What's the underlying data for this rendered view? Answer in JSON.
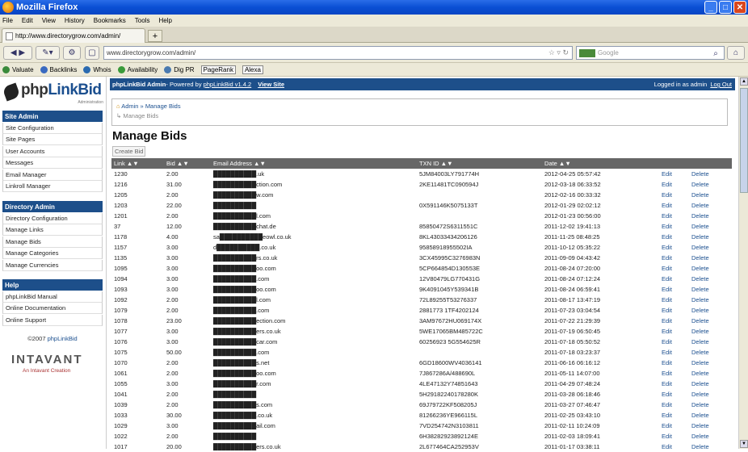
{
  "window": {
    "title": "Mozilla Firefox",
    "min": "_",
    "max": "□",
    "close": "✕"
  },
  "menu": [
    "File",
    "Edit",
    "View",
    "History",
    "Bookmarks",
    "Tools",
    "Help"
  ],
  "tab": {
    "title": "http://www.directorygrow.com/admin/",
    "new": "+"
  },
  "nav": {
    "url": "www.directorygrow.com/admin/",
    "search_placeholder": "Google"
  },
  "bookmarks": [
    {
      "label": "Valuate",
      "color": "#3a8a3a"
    },
    {
      "label": "Backlinks",
      "color": "#3a6ac0"
    },
    {
      "label": "Whois",
      "color": "#2a6ab0"
    },
    {
      "label": "Availability",
      "color": "#3a9a3a"
    },
    {
      "label": "Dig PR",
      "color": "#4a7ab0"
    },
    {
      "label": "PageRank",
      "color": ""
    },
    {
      "label": "Alexa",
      "color": ""
    }
  ],
  "sidebar": {
    "logo": {
      "brand_a": "php",
      "brand_b": "LinkBid",
      "sub": "Administration"
    },
    "sections": [
      {
        "title": "Site Admin",
        "items": [
          "Site Configuration",
          "Site Pages",
          "User Accounts",
          "Messages",
          "Email Manager",
          "Linkroll Manager"
        ]
      },
      {
        "title": "Directory Admin",
        "items": [
          "Directory Configuration",
          "Manage Links",
          "Manage Bids",
          "Manage Categories",
          "Manage Currencies"
        ]
      },
      {
        "title": "Help",
        "items": [
          "phpLinkBid Manual",
          "Online Documentation",
          "Online Support"
        ]
      }
    ],
    "copyright_pre": "©2007 ",
    "copyright_link": "phpLinkBid",
    "company": "INTAVANT",
    "company_sub": "An Intavant Creation"
  },
  "header": {
    "title": "phpLinkBid Admin",
    "powered": " - Powered by ",
    "version": "phpLinkBid v1.4.2",
    "view_site": "View Site",
    "login_text": "Logged in as admin",
    "logout": "Log Out"
  },
  "breadcrumb": {
    "admin": "Admin",
    "sep": " » ",
    "current": "Manage Bids",
    "sub": "Manage Bids"
  },
  "page": {
    "title": "Manage Bids",
    "create": "Create Bid"
  },
  "table": {
    "headers": [
      "Link ▲▼",
      "Bid ▲▼",
      "Email Address ▲▼",
      "TXN ID ▲▼",
      "Date ▲▼",
      "",
      ""
    ],
    "rows": [
      [
        "1230",
        "2.00",
        "██████████.uk",
        "5JM84003LY791774H",
        "2012-04-25 05:57:42",
        "Edit",
        "Delete"
      ],
      [
        "1216",
        "31.00",
        "██████████ction.com",
        "2KE11481TC090594J",
        "2012-03-18 06:33:52",
        "Edit",
        "Delete"
      ],
      [
        "1205",
        "2.00",
        "██████████w.com",
        "",
        "2012-02-16 00:33:32",
        "Edit",
        "Delete"
      ],
      [
        "1203",
        "22.00",
        "██████████",
        "0X591146K5075133T",
        "2012-01-29 02:02:12",
        "Edit",
        "Delete"
      ],
      [
        "1201",
        "2.00",
        "██████████l.com",
        "",
        "2012-01-23 00:56:00",
        "Edit",
        "Delete"
      ],
      [
        "37",
        "12.00",
        "██████████chat.de",
        "85850472S6311551C",
        "2011-12-02 19:41:13",
        "Edit",
        "Delete"
      ],
      [
        "1178",
        "4.00",
        "sa██████████eowl.co.uk",
        "8KL43033434206126",
        "2011-11-25 08:48:25",
        "Edit",
        "Delete"
      ],
      [
        "1157",
        "3.00",
        "d██████████.co.uk",
        "95858918955502IA",
        "2011-10-12 05:35:22",
        "Edit",
        "Delete"
      ],
      [
        "1135",
        "3.00",
        "██████████rs.co.uk",
        "3CX45995C3276983N",
        "2011-09-09 04:43:42",
        "Edit",
        "Delete"
      ],
      [
        "1095",
        "3.00",
        "██████████oo.com",
        "5CP664854D130553E",
        "2011-08-24 07:20:00",
        "Edit",
        "Delete"
      ],
      [
        "1094",
        "3.00",
        "██████████.com",
        "12V80479LG770431G",
        "2011-08-24 07:12:24",
        "Edit",
        "Delete"
      ],
      [
        "1093",
        "3.00",
        "██████████oo.com",
        "9K4091045Y539341B",
        "2011-08-24 06:59:41",
        "Edit",
        "Delete"
      ],
      [
        "1092",
        "2.00",
        "██████████l.com",
        "72L89255T53276337",
        "2011-08-17 13:47:19",
        "Edit",
        "Delete"
      ],
      [
        "1079",
        "2.00",
        "██████████.com",
        "2881773 1TF4202124",
        "2011-07-23 03:04:54",
        "Edit",
        "Delete"
      ],
      [
        "1078",
        "23.00",
        "██████████ection.com",
        "3AM97672HU069174X",
        "2011-07-22 21:29:39",
        "Edit",
        "Delete"
      ],
      [
        "1077",
        "3.00",
        "██████████ers.co.uk",
        "5WE17065BM485722C",
        "2011-07-19 06:50:45",
        "Edit",
        "Delete"
      ],
      [
        "1076",
        "3.00",
        "██████████car.com",
        "60256923 5G554625R",
        "2011-07-18 05:50:52",
        "Edit",
        "Delete"
      ],
      [
        "1075",
        "50.00",
        "██████████.com",
        "",
        "2011-07-18 03:23:37",
        "Edit",
        "Delete"
      ],
      [
        "1070",
        "2.00",
        "██████████s.net",
        "6GD18600WV4036141",
        "2011-06-16 06:16:12",
        "Edit",
        "Delete"
      ],
      [
        "1061",
        "2.00",
        "██████████oo.com",
        "7J867286A/488690L",
        "2011-05-11 14:07:00",
        "Edit",
        "Delete"
      ],
      [
        "1055",
        "3.00",
        "██████████r.com",
        "4LE47132Y74851643",
        "2011-04-29 07:48:24",
        "Edit",
        "Delete"
      ],
      [
        "1041",
        "2.00",
        "██████████",
        "5H29182240178280K",
        "2011-03-28 06:18:46",
        "Edit",
        "Delete"
      ],
      [
        "1039",
        "2.00",
        "██████████s.com",
        "69J79722KF508205J",
        "2011-03-27 07:46:47",
        "Edit",
        "Delete"
      ],
      [
        "1033",
        "30.00",
        "██████████.co.uk",
        "81266236YE966115L",
        "2011-02-25 03:43:10",
        "Edit",
        "Delete"
      ],
      [
        "1029",
        "3.00",
        "██████████ail.com",
        "7VD254742N3103811",
        "2011-02-11 10:24:09",
        "Edit",
        "Delete"
      ],
      [
        "1022",
        "2.00",
        "██████████",
        "6H38282923892124E",
        "2011-02-03 18:09:41",
        "Edit",
        "Delete"
      ],
      [
        "1017",
        "20.00",
        "██████████ers.co.uk",
        "2L677464CA252953V",
        "2011-01-17 03:38:11",
        "Edit",
        "Delete"
      ]
    ]
  }
}
